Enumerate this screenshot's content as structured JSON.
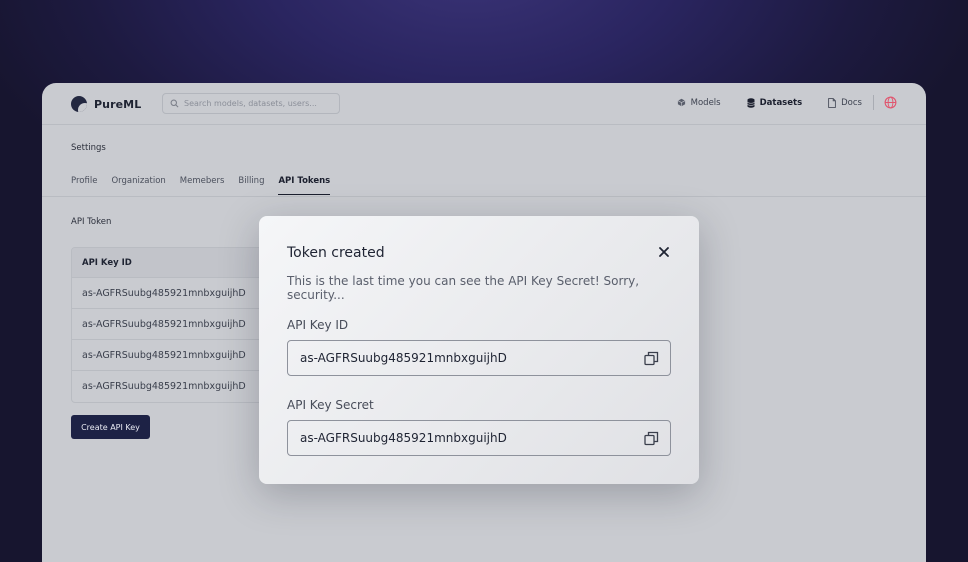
{
  "app": {
    "name": "PureML"
  },
  "search": {
    "placeholder": "Search models, datasets, users..."
  },
  "nav": {
    "items": [
      {
        "label": "Models",
        "icon": "cube-icon",
        "active": false
      },
      {
        "label": "Datasets",
        "icon": "database-icon",
        "active": true
      },
      {
        "label": "Docs",
        "icon": "document-icon",
        "active": false
      }
    ],
    "globe_icon": "globe-icon"
  },
  "settings": {
    "title": "Settings",
    "tabs": [
      {
        "label": "Profile",
        "active": false
      },
      {
        "label": "Organization",
        "active": false
      },
      {
        "label": "Memebers",
        "active": false
      },
      {
        "label": "Billing",
        "active": false
      },
      {
        "label": "API Tokens",
        "active": true
      }
    ]
  },
  "api_token": {
    "section_label": "API Token",
    "table_header": "API Key ID",
    "rows": [
      "as-AGFRSuubg485921mnbxguijhD",
      "as-AGFRSuubg485921mnbxguijhD",
      "as-AGFRSuubg485921mnbxguijhD",
      "as-AGFRSuubg485921mnbxguijhD"
    ],
    "create_button": "Create API Key"
  },
  "modal": {
    "title": "Token created",
    "description": "This is the last time you can see the API Key Secret! Sorry, security...",
    "key_id_label": "API Key ID",
    "key_id_value": "as-AGFRSuubg485921mnbxguijhD",
    "key_secret_label": "API Key Secret",
    "key_secret_value": "as-AGFRSuubg485921mnbxguijhD"
  },
  "colors": {
    "primary_button": "#1d2245",
    "background": "#2a2560",
    "accent_globe": "#e0566f"
  }
}
